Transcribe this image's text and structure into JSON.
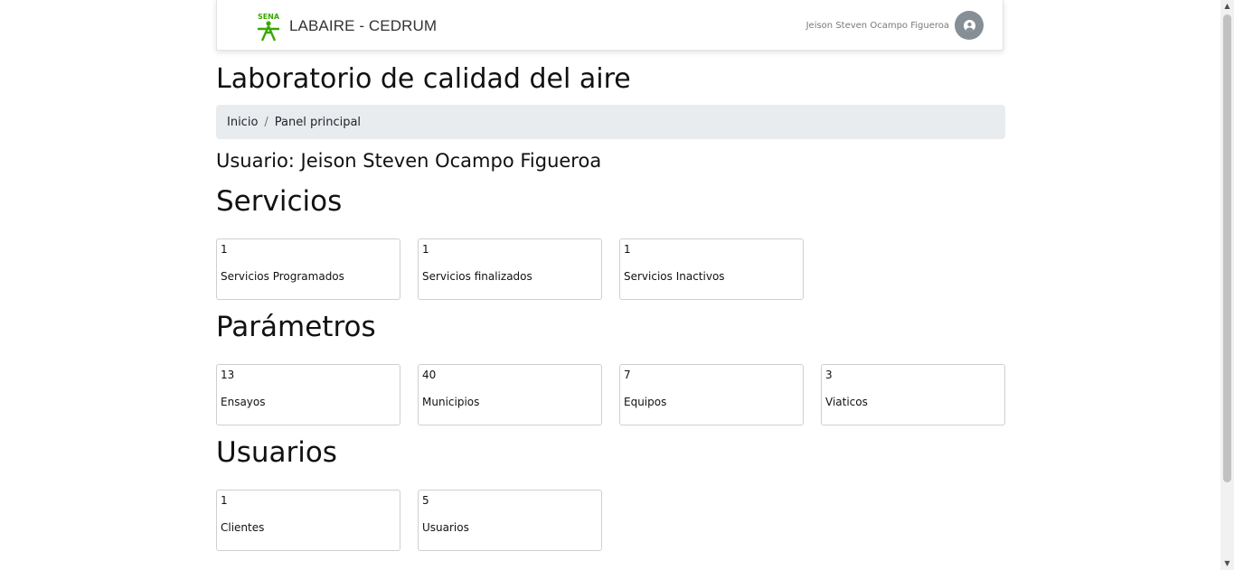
{
  "header": {
    "logo_text": "SENA",
    "brand": "LABAIRE - CEDRUM",
    "user_name": "Jeison Steven Ocampo Figueroa"
  },
  "page_title": "Laboratorio de calidad del aire",
  "breadcrumb": {
    "items": [
      "Inicio",
      "Panel principal"
    ],
    "separator": "/"
  },
  "user_line": "Usuario: Jeison Steven Ocampo Figueroa",
  "sections": {
    "servicios": {
      "title": "Servicios",
      "cards": [
        {
          "count": "1",
          "label": "Servicios Programados"
        },
        {
          "count": "1",
          "label": "Servicios finalizados"
        },
        {
          "count": "1",
          "label": "Servicios Inactivos"
        }
      ]
    },
    "parametros": {
      "title": "Parámetros",
      "cards": [
        {
          "count": "13",
          "label": "Ensayos"
        },
        {
          "count": "40",
          "label": "Municipios"
        },
        {
          "count": "7",
          "label": "Equipos"
        },
        {
          "count": "3",
          "label": "Viaticos"
        }
      ]
    },
    "usuarios": {
      "title": "Usuarios",
      "cards": [
        {
          "count": "1",
          "label": "Clientes"
        },
        {
          "count": "5",
          "label": "Usuarios"
        }
      ]
    }
  },
  "icons": {
    "logo": "sena-logo-icon",
    "avatar": "user-circle-icon",
    "scroll_up": "chevron-up-icon",
    "scroll_down": "chevron-down-icon"
  },
  "colors": {
    "brand_green": "#39a900",
    "breadcrumb_bg": "#e9ecef",
    "avatar_bg": "#868e96"
  }
}
